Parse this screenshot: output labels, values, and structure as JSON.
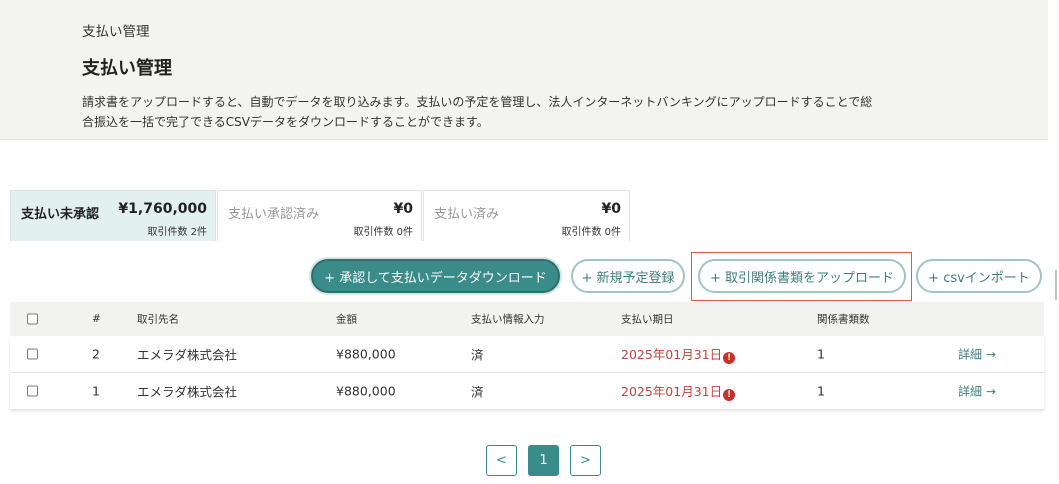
{
  "header": {
    "breadcrumb": "支払い管理",
    "title": "支払い管理",
    "description_line1": "請求書をアップロードすると、自動でデータを取り込みます。支払いの予定を管理し、法人インターネットバンキングにアップロードすることで総",
    "description_line2": "合振込を一括で完了できるCSVデータをダウンロードすることができます。"
  },
  "tabs": [
    {
      "label": "支払い未承認",
      "amount": "¥1,760,000",
      "count": "取引件数 2件",
      "active": true
    },
    {
      "label": "支払い承認済み",
      "amount": "¥0",
      "count": "取引件数 0件",
      "active": false
    },
    {
      "label": "支払い済み",
      "amount": "¥0",
      "count": "取引件数 0件",
      "active": false
    }
  ],
  "actions": {
    "approve_download": "+ 承認して支払いデータダウンロード",
    "new_schedule": "+ 新規予定登録",
    "upload_documents": "+ 取引関係書類をアップロード",
    "csv_import": "+ csvインポート"
  },
  "table": {
    "headers": {
      "num": "#",
      "partner": "取引先名",
      "amount": "金額",
      "payment_info": "支払い情報入力",
      "due_date": "支払い期日",
      "doc_count": "関係書類数"
    },
    "rows": [
      {
        "num": "2",
        "partner": "エメラダ株式会社",
        "amount": "¥880,000",
        "payment_info": "済",
        "due_date": "2025年01月31日",
        "doc_count": "1",
        "detail": "詳細 →"
      },
      {
        "num": "1",
        "partner": "エメラダ株式会社",
        "amount": "¥880,000",
        "payment_info": "済",
        "due_date": "2025年01月31日",
        "doc_count": "1",
        "detail": "詳細 →"
      }
    ]
  },
  "pagination": {
    "prev": "<",
    "current": "1",
    "next": ">"
  },
  "icons": {
    "warning": "exclamation-circle-icon",
    "checkbox": "checkbox-icon"
  },
  "colors": {
    "accent": "#3a8c8b",
    "warning": "#c0453f",
    "highlight": "#e25656"
  }
}
